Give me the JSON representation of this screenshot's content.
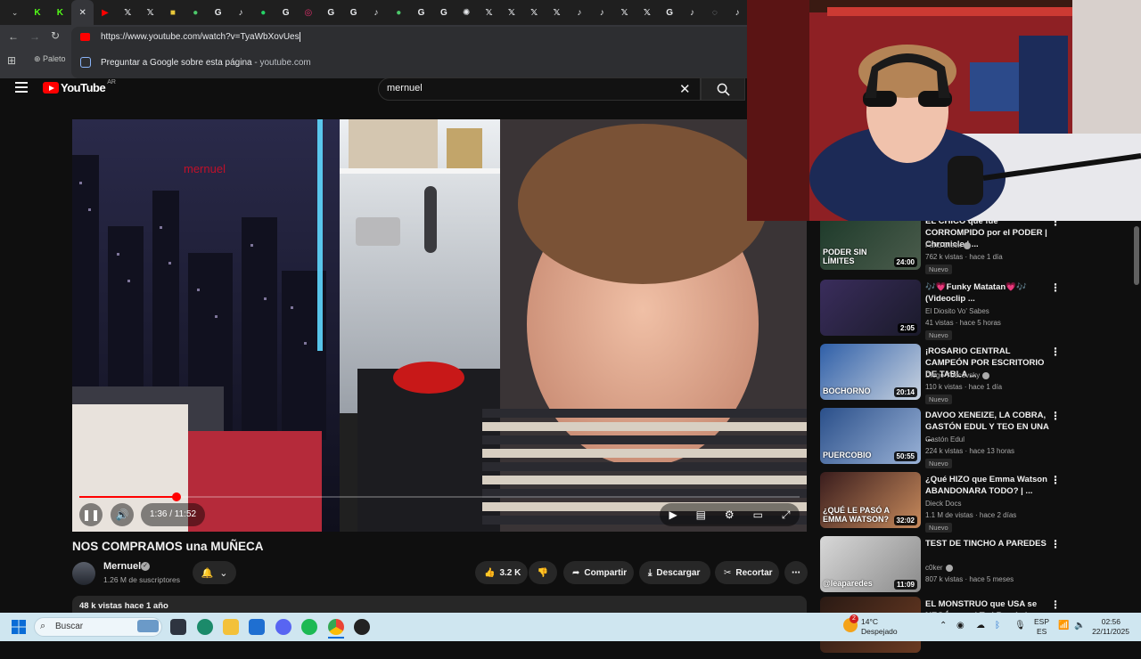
{
  "browser": {
    "tab_favicons": [
      {
        "icon": "k-icon",
        "color": "#53fc18",
        "glyph": "K"
      },
      {
        "icon": "k-icon",
        "color": "#53fc18",
        "glyph": "K"
      },
      {
        "icon": "close-icon",
        "color": "#e8eaed",
        "glyph": "✕"
      },
      {
        "icon": "youtube-icon",
        "color": "#ff0000",
        "glyph": "▶"
      },
      {
        "icon": "x-icon",
        "color": "#e8eaed",
        "glyph": "𝕏"
      },
      {
        "icon": "x-icon",
        "color": "#e8eaed",
        "glyph": "𝕏"
      },
      {
        "icon": "app-icon",
        "color": "#e9c83a",
        "glyph": "■"
      },
      {
        "icon": "green-icon",
        "color": "#4cc76a",
        "glyph": "●"
      },
      {
        "icon": "google-icon",
        "color": "#e8eaed",
        "glyph": "G"
      },
      {
        "icon": "tiktok-icon",
        "color": "#e8eaed",
        "glyph": "♪"
      },
      {
        "icon": "whatsapp-icon",
        "color": "#25d366",
        "glyph": "●"
      },
      {
        "icon": "google-icon",
        "color": "#e8eaed",
        "glyph": "G"
      },
      {
        "icon": "instagram-icon",
        "color": "#e1306c",
        "glyph": "◎"
      },
      {
        "icon": "google-icon",
        "color": "#e8eaed",
        "glyph": "G"
      },
      {
        "icon": "google-icon",
        "color": "#e8eaed",
        "glyph": "G"
      },
      {
        "icon": "tiktok-icon",
        "color": "#e8eaed",
        "glyph": "♪"
      },
      {
        "icon": "green-icon",
        "color": "#4cc76a",
        "glyph": "●"
      },
      {
        "icon": "google-icon",
        "color": "#e8eaed",
        "glyph": "G"
      },
      {
        "icon": "google-icon",
        "color": "#e8eaed",
        "glyph": "G"
      },
      {
        "icon": "openai-icon",
        "color": "#e8eaed",
        "glyph": "✺"
      },
      {
        "icon": "x-icon",
        "color": "#e8eaed",
        "glyph": "𝕏"
      },
      {
        "icon": "x-icon",
        "color": "#e8eaed",
        "glyph": "𝕏"
      },
      {
        "icon": "x-icon",
        "color": "#e8eaed",
        "glyph": "𝕏"
      },
      {
        "icon": "x-icon",
        "color": "#e8eaed",
        "glyph": "𝕏"
      },
      {
        "icon": "tiktok-icon",
        "color": "#e8eaed",
        "glyph": "♪"
      },
      {
        "icon": "tiktok-icon",
        "color": "#e8eaed",
        "glyph": "♪"
      },
      {
        "icon": "x-icon",
        "color": "#e8eaed",
        "glyph": "𝕏"
      },
      {
        "icon": "x-icon",
        "color": "#e8eaed",
        "glyph": "𝕏"
      },
      {
        "icon": "google-icon",
        "color": "#e8eaed",
        "glyph": "G"
      },
      {
        "icon": "tiktok-icon",
        "color": "#e8eaed",
        "glyph": "♪"
      },
      {
        "icon": "globe-icon",
        "color": "#9aa0a6",
        "glyph": "◌"
      },
      {
        "icon": "tiktok-icon",
        "color": "#e8eaed",
        "glyph": "♪"
      }
    ],
    "url": "https://www.youtube.com/watch?v=TyaWbXovUes",
    "suggestion": "Preguntar a Google sobre esta página",
    "suggestion_domain": "youtube.com",
    "bookmark_first": "Paleto"
  },
  "youtube": {
    "logo_text": "YouTube",
    "country": "AR",
    "search_query": "mernuel",
    "accent": "#ff0000"
  },
  "player": {
    "watermark_text": "mernuel",
    "current_time": "1:36",
    "duration": "11:52",
    "time_display": "1:36 / 11:52",
    "progress": 0.135
  },
  "video": {
    "title": "NOS COMPRAMOS una MUÑECA",
    "channel": "Mernuel",
    "subscribers": "1.26 M de suscriptores",
    "likes": "3.2 K",
    "share_label": "Compartir",
    "download_label": "Descargar",
    "clip_label": "Recortar",
    "views_age": "48 k vistas  hace 1 año"
  },
  "recommendations": [
    {
      "title": "EL CHICO que fue CORROMPIDO por el PODER | Chronicle | ...",
      "channel": "Farid Dieck",
      "verified": true,
      "meta": "762 k vistas · hace 1 día",
      "badge": "Nuevo",
      "duration": "24:00",
      "thumb_text": "PODER SIN LÍMITES",
      "thumb_colors": [
        "#1d3a2a",
        "#4b5c4c"
      ]
    },
    {
      "title": "🎶💗Funky Matatan💗🎶 (Videoclip ...",
      "channel": "El Diosito Vo' Sabes",
      "verified": false,
      "meta": "41 vistas · hace 5 horas",
      "badge": "Nuevo",
      "duration": "2:05",
      "thumb_text": "",
      "thumb_colors": [
        "#3a2d5c",
        "#1a1a2a"
      ]
    },
    {
      "title": "¡ROSARIO CENTRAL CAMPEÓN POR ESCRITORIO DE TABLA ...",
      "channel": "Diego Yudcovsky",
      "verified": true,
      "meta": "110 k vistas · hace 1 día",
      "badge": "Nuevo",
      "duration": "20:14",
      "thumb_text": "BOCHORNO",
      "thumb_colors": [
        "#2f5fa8",
        "#c9d3e0"
      ]
    },
    {
      "title": "DAVOO XENEIZE, LA COBRA, GASTÓN EDUL Y TEO EN UNA ...",
      "channel": "Gastón Edul",
      "verified": false,
      "meta": "224 k vistas · hace 13 horas",
      "badge": "Nuevo",
      "duration": "50:55",
      "thumb_text": "PUERCOBIO",
      "thumb_colors": [
        "#2a4f8a",
        "#9ab2d6"
      ]
    },
    {
      "title": "¿Qué HIZO que Emma Watson ABANDONARA TODO? | ...",
      "channel": "Dieck Docs",
      "verified": false,
      "meta": "1.1 M de vistas · hace 2 días",
      "badge": "Nuevo",
      "duration": "32:02",
      "thumb_text": "¿QUÉ LE PASÓ A EMMA WATSON?",
      "thumb_colors": [
        "#3a1d1d",
        "#c78a5c"
      ]
    },
    {
      "title": "TEST DE TINCHO A PAREDES",
      "channel": "c0ker",
      "verified": true,
      "meta": "807 k vistas · hace 5 meses",
      "badge": "",
      "duration": "11:09",
      "thumb_text": "@leaparedes",
      "thumb_colors": [
        "#d8d8d8",
        "#8a8a8a"
      ]
    },
    {
      "title": "EL MONSTRUO que USA se NEGÓ a ver | Ted Bundy | ...",
      "channel": "",
      "verified": false,
      "meta": "",
      "badge": "",
      "duration": "",
      "thumb_text": "",
      "thumb_colors": [
        "#2a1a14",
        "#6a3a22"
      ]
    }
  ],
  "taskbar": {
    "search_placeholder": "Buscar",
    "weather_temp": "14°C",
    "weather_desc": "Despejado",
    "lang_top": "ESP",
    "lang_bottom": "ES",
    "time": "02:56",
    "date": "22/11/2025",
    "notif_count": "2"
  }
}
